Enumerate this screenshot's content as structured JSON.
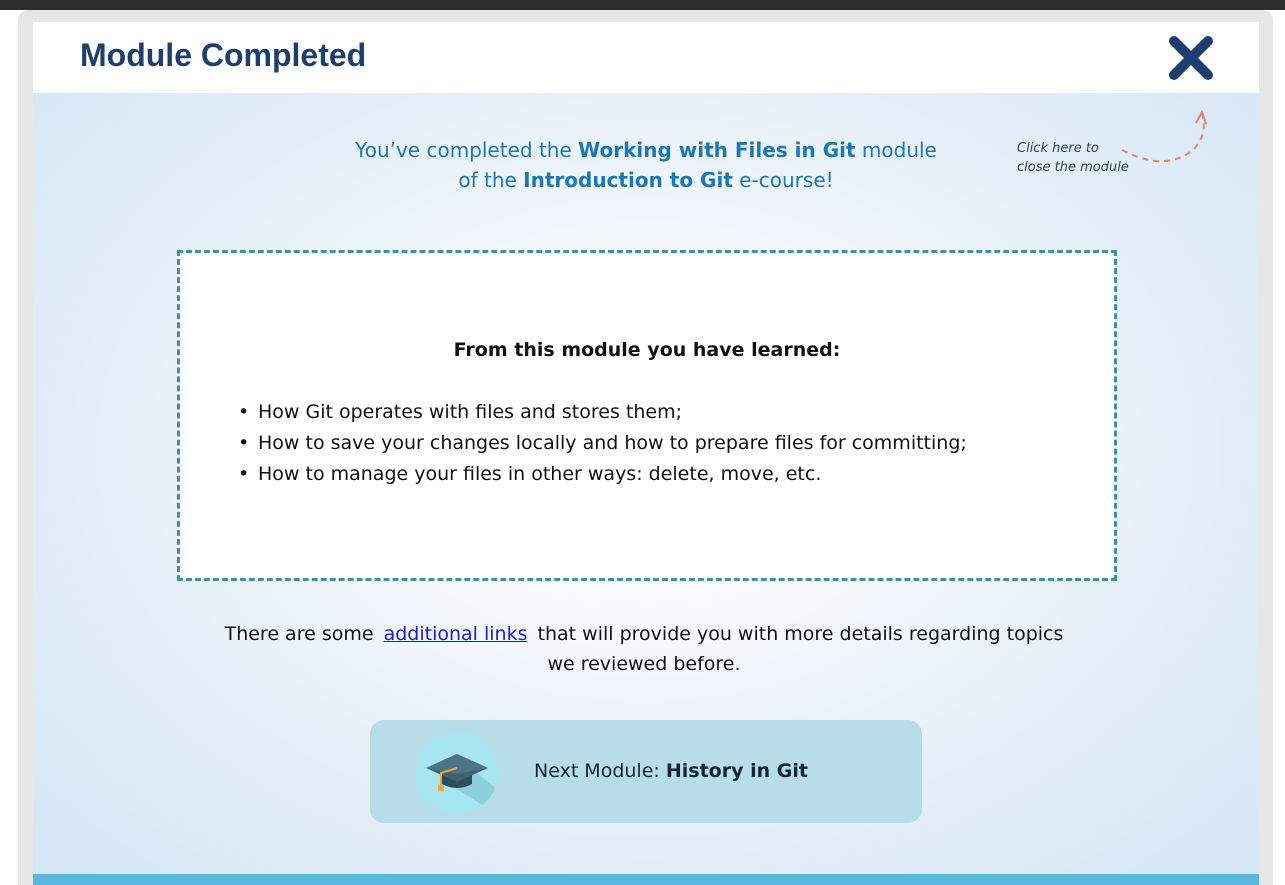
{
  "header": {
    "title": "Module Completed"
  },
  "intro": {
    "prefix": "You’ve completed the",
    "module_name": "Working with Files in Git",
    "middle": "module",
    "line2_prefix": "of the",
    "course_name": "Introduction to Git",
    "suffix": "e-course!"
  },
  "hint": {
    "line1": "Click here to",
    "line2": "close the module"
  },
  "learned": {
    "title": "From this module you have learned:",
    "items": [
      "How Git operates with files and stores them;",
      "How to save your changes locally and how to prepare files for committing;",
      "How to manage your files in other ways: delete, move, etc."
    ]
  },
  "additional": {
    "prefix": "There are some",
    "link_label": "additional links",
    "suffix": "that will provide you with more details regarding topics",
    "line2": "we reviewed before."
  },
  "next_module": {
    "prefix": "Next Module:",
    "name": "History in Git",
    "icon": "graduation-cap-icon"
  },
  "colors": {
    "title": "#1d3e6e",
    "close": "#1d3e6e",
    "intro": "#1a78b8",
    "link": "#1b1bd6",
    "dashed_border": "#3e8fa9",
    "next_button_bg": "#b7dde8",
    "bottom_bar": "#5bb6e0",
    "hint_arrow": "#ef7e6c"
  }
}
